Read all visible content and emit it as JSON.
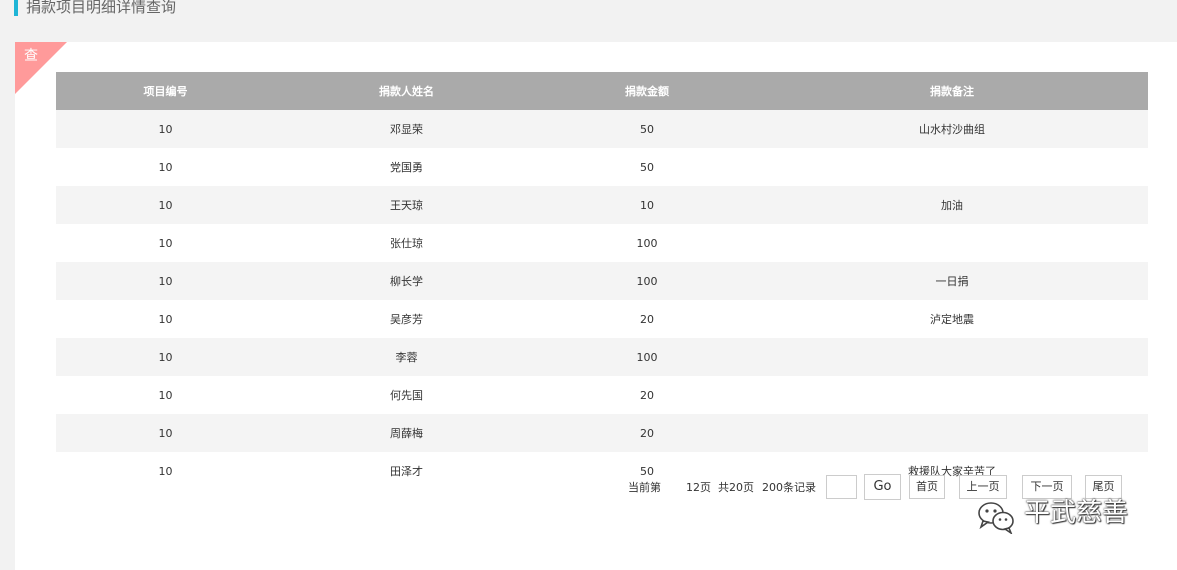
{
  "page": {
    "title": "捐款项目明细详情查询",
    "corner_tag": "查"
  },
  "table": {
    "headers": [
      "项目编号",
      "捐款人姓名",
      "捐款金额",
      "捐款备注"
    ],
    "rows": [
      [
        "10",
        "邓显荣",
        "50",
        "山水村沙曲组"
      ],
      [
        "10",
        "党国勇",
        "50",
        ""
      ],
      [
        "10",
        "王天琼",
        "10",
        "加油"
      ],
      [
        "10",
        "张仕琼",
        "100",
        ""
      ],
      [
        "10",
        "柳长学",
        "100",
        "一日捐"
      ],
      [
        "10",
        "吴彦芳",
        "20",
        "泸定地震"
      ],
      [
        "10",
        "李蓉",
        "100",
        ""
      ],
      [
        "10",
        "何先国",
        "20",
        ""
      ],
      [
        "10",
        "周薛梅",
        "20",
        ""
      ],
      [
        "10",
        "田泽才",
        "50",
        "救援队大家辛苦了"
      ]
    ]
  },
  "pager": {
    "current_label": "当前第",
    "current_page": "12页",
    "total_pages": "共20页",
    "total_records": "200条记录",
    "page_input_value": "",
    "go_label": "Go",
    "first_label": "首页",
    "prev_label": "上一页",
    "next_label": "下一页",
    "last_label": "尾页"
  },
  "watermark": {
    "text": "平武慈善",
    "icon": "wechat-icon"
  },
  "colors": {
    "accent": "#1fb5d6",
    "corner_tag": "#ff9a9a",
    "header_bg": "#aaaaaa",
    "stripe_bg": "#f4f4f4"
  }
}
